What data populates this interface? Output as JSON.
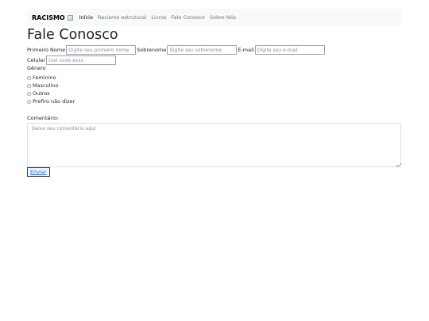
{
  "navbar": {
    "brand": "RACISMO",
    "links": [
      {
        "label": "Início",
        "active": true
      },
      {
        "label": "Racismo estrutural",
        "active": false
      },
      {
        "label": "Livros",
        "active": false
      },
      {
        "label": "Fale Conosco",
        "active": false
      },
      {
        "label": "Sobre Nós",
        "active": false
      }
    ]
  },
  "page": {
    "title": "Fale Conosco"
  },
  "form": {
    "first_name": {
      "label": "Primeiro Nome",
      "placeholder": "Digite seu primeiro nome",
      "value": ""
    },
    "last_name": {
      "label": "Sobrenome",
      "placeholder": "Digite seu sobrenome",
      "value": ""
    },
    "email": {
      "label": "E-mail",
      "placeholder": "Digite seu e-mail",
      "value": ""
    },
    "phone": {
      "label": "Celular",
      "placeholder": "(xx) xxxx-xxxx",
      "value": ""
    },
    "gender": {
      "label": "Gênero",
      "options": [
        "Feminino",
        "Masculino",
        "Outros",
        "Prefiro não dizer"
      ]
    },
    "comment": {
      "label": "Comentário:",
      "placeholder": "Deixe seu comentário aqui",
      "value": ""
    },
    "submit_label": "Enviar"
  },
  "colors": {
    "navbar_bg": "#f8f9fa",
    "link_muted": "#6c757d",
    "link_active": "#000000",
    "submit_text": "#0d6efd"
  }
}
